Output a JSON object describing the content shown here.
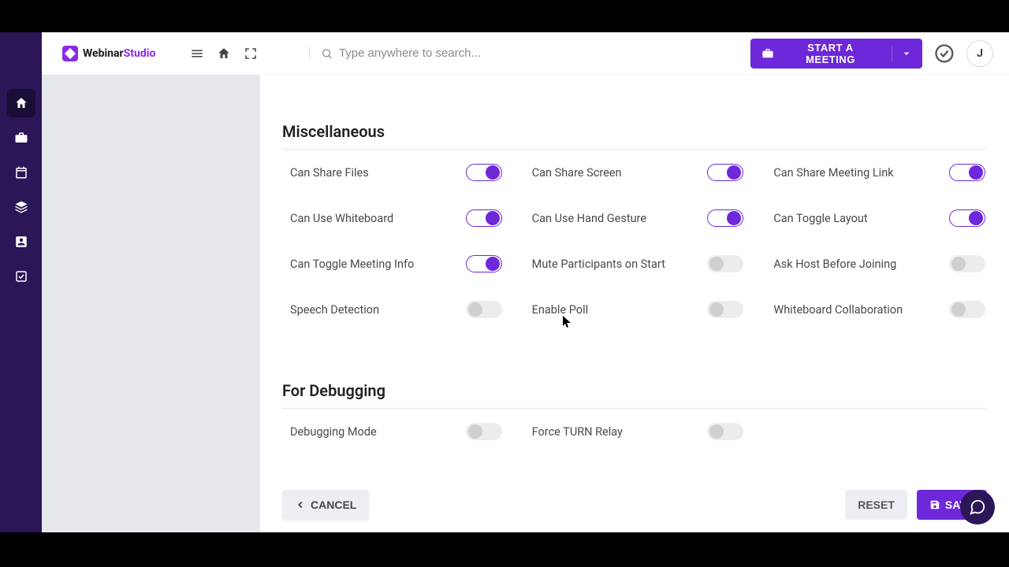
{
  "brand": {
    "name1": "Webinar",
    "name2": "Studio"
  },
  "search": {
    "placeholder": "Type anywhere to search..."
  },
  "topbar": {
    "start_label": "START A MEETING",
    "avatar_initial": "J"
  },
  "sections": {
    "misc_title": "Miscellaneous",
    "debug_title": "For Debugging"
  },
  "options": {
    "can_share_files": "Can Share Files",
    "can_share_screen": "Can Share Screen",
    "can_share_link": "Can Share Meeting Link",
    "can_whiteboard": "Can Use Whiteboard",
    "can_hand_gesture": "Can Use Hand Gesture",
    "can_toggle_layout": "Can Toggle Layout",
    "can_toggle_info": "Can Toggle Meeting Info",
    "mute_on_start": "Mute Participants on Start",
    "ask_host": "Ask Host Before Joining",
    "speech_detection": "Speech Detection",
    "enable_poll": "Enable Poll",
    "wb_collab": "Whiteboard Collaboration",
    "debug_mode": "Debugging Mode",
    "force_turn": "Force TURN Relay"
  },
  "states": {
    "can_share_files": true,
    "can_share_screen": true,
    "can_share_link": true,
    "can_whiteboard": true,
    "can_hand_gesture": true,
    "can_toggle_layout": true,
    "can_toggle_info": true,
    "mute_on_start": false,
    "ask_host": false,
    "speech_detection": false,
    "enable_poll": false,
    "wb_collab": false,
    "debug_mode": false,
    "force_turn": false
  },
  "footer": {
    "cancel": "CANCEL",
    "reset": "RESET",
    "save": "SAVE"
  }
}
